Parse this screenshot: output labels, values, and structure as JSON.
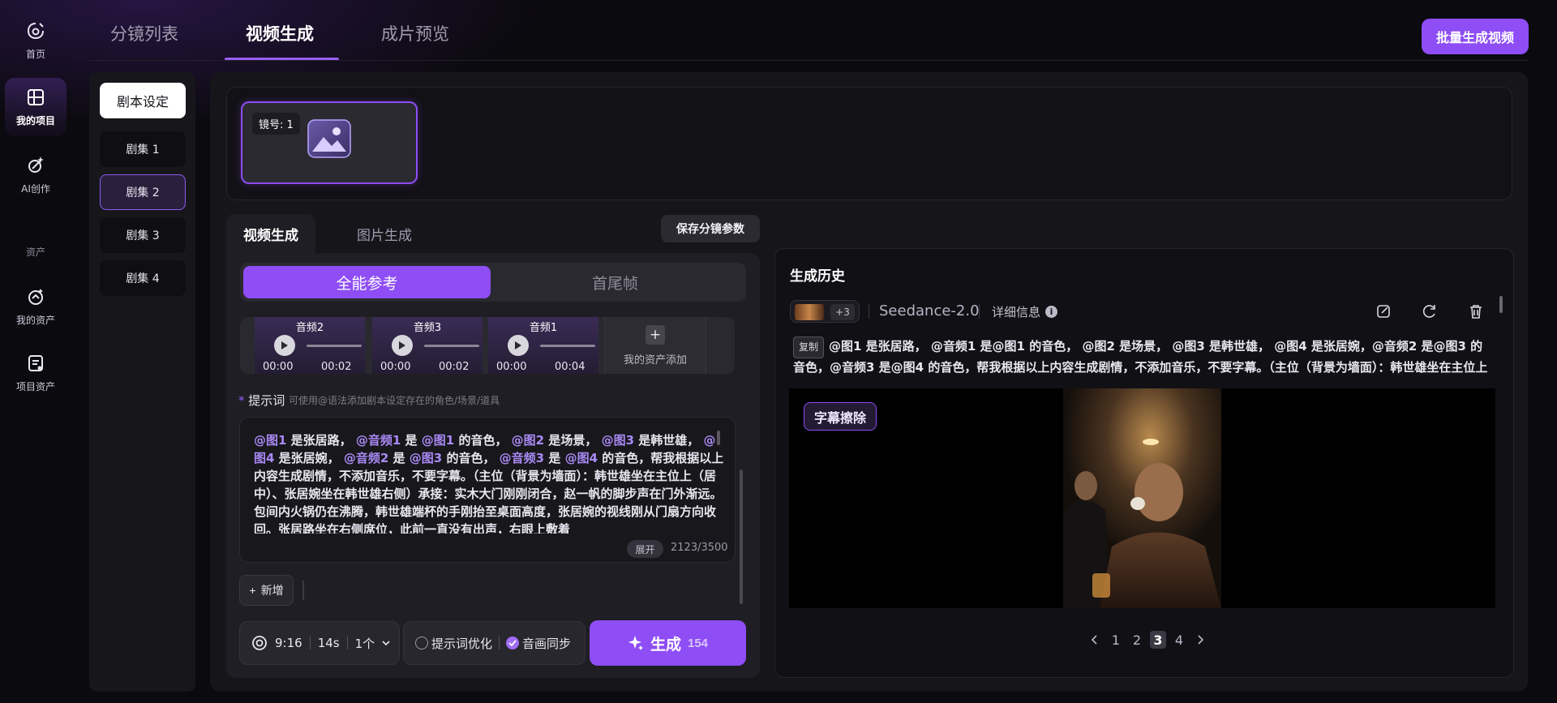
{
  "rail": {
    "items": [
      {
        "label": "首页",
        "icon": "home-icon"
      },
      {
        "label": "我的项目",
        "icon": "projects-icon"
      },
      {
        "label": "AI创作",
        "icon": "ai-create-icon"
      }
    ],
    "section_label": "资产",
    "asset_items": [
      {
        "label": "我的资产",
        "icon": "my-assets-icon"
      },
      {
        "label": "项目资产",
        "icon": "project-assets-icon"
      }
    ]
  },
  "top_tabs": [
    "分镜列表",
    "视频生成",
    "成片预览"
  ],
  "batch_button": "批量生成视频",
  "episodes": {
    "script_settings": "剧本设定",
    "items": [
      "剧集 1",
      "剧集 2",
      "剧集 3",
      "剧集 4"
    ],
    "active_index": 1
  },
  "shot": {
    "label": "镜号: 1"
  },
  "gen": {
    "tabs": [
      "视频生成",
      "图片生成"
    ],
    "save_button": "保存分镜参数",
    "modes": [
      "全能参考",
      "首尾帧"
    ],
    "audio_cards": [
      {
        "name": "音频2",
        "start": "00:00",
        "end": "00:02"
      },
      {
        "name": "音频3",
        "start": "00:00",
        "end": "00:02"
      },
      {
        "name": "音频1",
        "start": "00:00",
        "end": "00:04"
      }
    ],
    "asset_add_label": "我的资产添加",
    "prompt_label": "提示词",
    "prompt_hint": "可使用@语法添加剧本设定存在的角色/场景/道具",
    "prompt_segments": [
      {
        "t": "@图1",
        "m": true
      },
      {
        "t": " 是张居路， ",
        "m": false
      },
      {
        "t": "@音频1",
        "m": true
      },
      {
        "t": " 是 ",
        "m": false
      },
      {
        "t": "@图1",
        "m": true
      },
      {
        "t": " 的音色， ",
        "m": false
      },
      {
        "t": "@图2",
        "m": true
      },
      {
        "t": " 是场景， ",
        "m": false
      },
      {
        "t": "@图3",
        "m": true
      },
      {
        "t": " 是韩世雄， ",
        "m": false
      },
      {
        "t": "@图4",
        "m": true
      },
      {
        "t": " 是张居婉， ",
        "m": false
      },
      {
        "t": "@音频2",
        "m": true
      },
      {
        "t": " 是 ",
        "m": false
      },
      {
        "t": "@图3",
        "m": true
      },
      {
        "t": " 的音色， ",
        "m": false
      },
      {
        "t": "@音频3",
        "m": true
      },
      {
        "t": " 是 ",
        "m": false
      },
      {
        "t": "@图4",
        "m": true
      },
      {
        "t": " 的音色，帮我根据以上内容生成剧情，不添加音乐，不要字幕。（主位（背景为墙面）：韩世雄坐在主位上（居中）、张居婉坐在韩世雄右侧）承接：实木大门刚刚闭合，赵一帆的脚步声在门外渐远。包间内火锅仍在沸腾，韩世雄端杯的手刚抬至桌面高度，张居婉的视线刚从门扇方向收回。张居路坐在右侧席位，此前一直没有出声，右眼上敷着",
        "m": false
      }
    ],
    "expand_button": "展开",
    "counter": "2123/3500",
    "new_button": "新增",
    "params": {
      "ratio": "9:16",
      "duration": "14s",
      "count": "1个"
    },
    "options": [
      {
        "label": "提示词优化",
        "checked": false
      },
      {
        "label": "音画同步",
        "checked": true
      }
    ],
    "generate_label": "生成",
    "generate_cost": "154"
  },
  "history": {
    "title": "生成历史",
    "extra_count": "+3",
    "model": "Seedance-2.0",
    "detail_label": "详细信息",
    "copy_tag": "复制",
    "description": "@图1 是张居路， @音频1 是@图1 的音色， @图2 是场景， @图3 是韩世雄， @图4 是张居婉，@音频2 是@图3 的音色，@音频3 是@图4 的音色，帮我根据以上内容生成剧情，不添加音乐，不要字幕。（主位（背景为墙面）：韩世雄坐在主位上（居中）、张居婉坐在韩世雄右侧）承接：实木大门刚刚闭合，赵一帆的脚步声在门外渐远。",
    "badge": "字幕擦除",
    "pages": [
      "1",
      "2",
      "3",
      "4"
    ],
    "active_page": "3"
  },
  "colors": {
    "accent": "#8e4df5",
    "mention": "#a98af5"
  }
}
